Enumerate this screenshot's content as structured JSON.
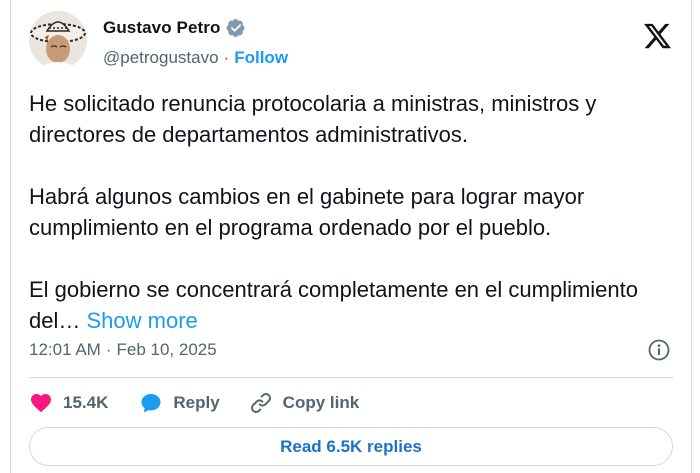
{
  "author": {
    "name": "Gustavo Petro",
    "handle": "@petrogustavo",
    "separator": "·",
    "follow_label": "Follow"
  },
  "tweet": {
    "paragraphs": [
      "He solicitado renuncia protocolaria a ministras, ministros y directores de departamentos administrativos.",
      "Habrá algunos cambios en el gabinete para lograr mayor cumplimiento en el programa ordenado por el pueblo.",
      "El gobierno se concentrará completamente en el cumplimiento del…"
    ],
    "show_more_label": "Show more",
    "time": "12:01 AM",
    "separator": "·",
    "date": "Feb 10, 2025"
  },
  "actions": {
    "like_count": "15.4K",
    "reply_label": "Reply",
    "copy_label": "Copy link"
  },
  "read_replies_label": "Read 6.5K replies",
  "colors": {
    "accent": "#1d9bf0",
    "like": "#f91880",
    "reply": "#1d9bf0",
    "text_secondary": "#536471",
    "border": "#cfd9de"
  },
  "icons": [
    "verified-badge-icon",
    "x-logo-icon",
    "info-icon",
    "heart-icon",
    "reply-bubble-icon",
    "link-icon"
  ]
}
